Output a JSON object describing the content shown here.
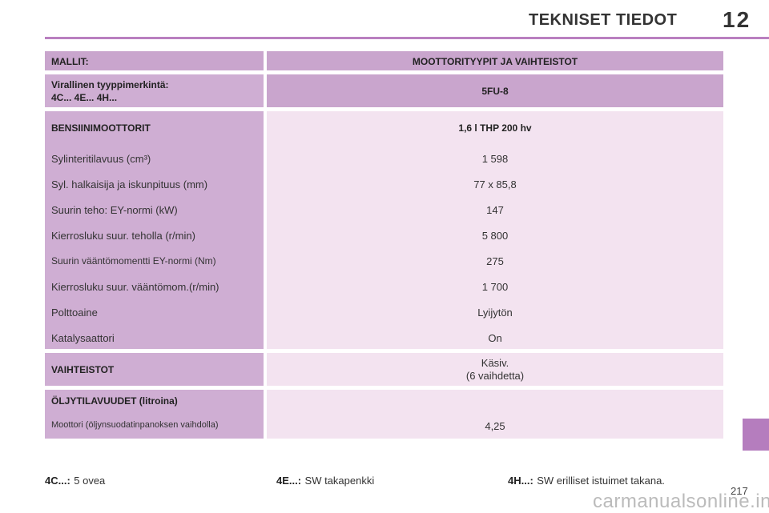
{
  "header": {
    "title": "TEKNISET TIEDOT",
    "chapter": "12"
  },
  "table": {
    "models_label": "MALLIT:",
    "engine_types_label": "MOOTTORITYYPIT JA VAIHTEISTOT",
    "official_type_label_1": "Virallinen tyyppimerkintä:",
    "official_type_label_2": "4C... 4E... 4H...",
    "official_type_value": "5FU-8",
    "petrol_label": "BENSIINIMOOTTORIT",
    "petrol_value": "1,6 l THP 200 hv",
    "rows": [
      {
        "label": "Sylinteritilavuus (cm³)",
        "value": "1 598"
      },
      {
        "label": "Syl. halkaisija ja iskunpituus (mm)",
        "value": "77 x 85,8"
      },
      {
        "label": "Suurin teho: EY-normi (kW)",
        "value": "147"
      },
      {
        "label": "Kierrosluku suur. teholla (r/min)",
        "value": "5 800"
      },
      {
        "label": "Suurin vääntömomentti EY-normi (Nm)",
        "value": "275"
      },
      {
        "label": "Kierrosluku suur. vääntömom.(r/min)",
        "value": "1 700"
      },
      {
        "label": "Polttoaine",
        "value": "Lyijytön"
      },
      {
        "label": "Katalysaattori",
        "value": "On"
      }
    ],
    "gearbox_label": "VAIHTEISTOT",
    "gearbox_value_1": "Käsiv.",
    "gearbox_value_2": "(6 vaihdetta)",
    "oil_label": "ÖLJYTILAVUUDET (litroina)",
    "oil_sub_label": "Moottori (öljynsuodatinpanoksen vaihdolla)",
    "oil_value": "4,25"
  },
  "footer": {
    "notes": [
      {
        "key": "4C...:",
        "text": "5 ovea"
      },
      {
        "key": "4E...:",
        "text": "SW takapenkki"
      },
      {
        "key": "4H...:",
        "text": "SW erilliset istuimet takana."
      }
    ],
    "page_number": "217",
    "watermark": "carmanualsonline.info"
  }
}
